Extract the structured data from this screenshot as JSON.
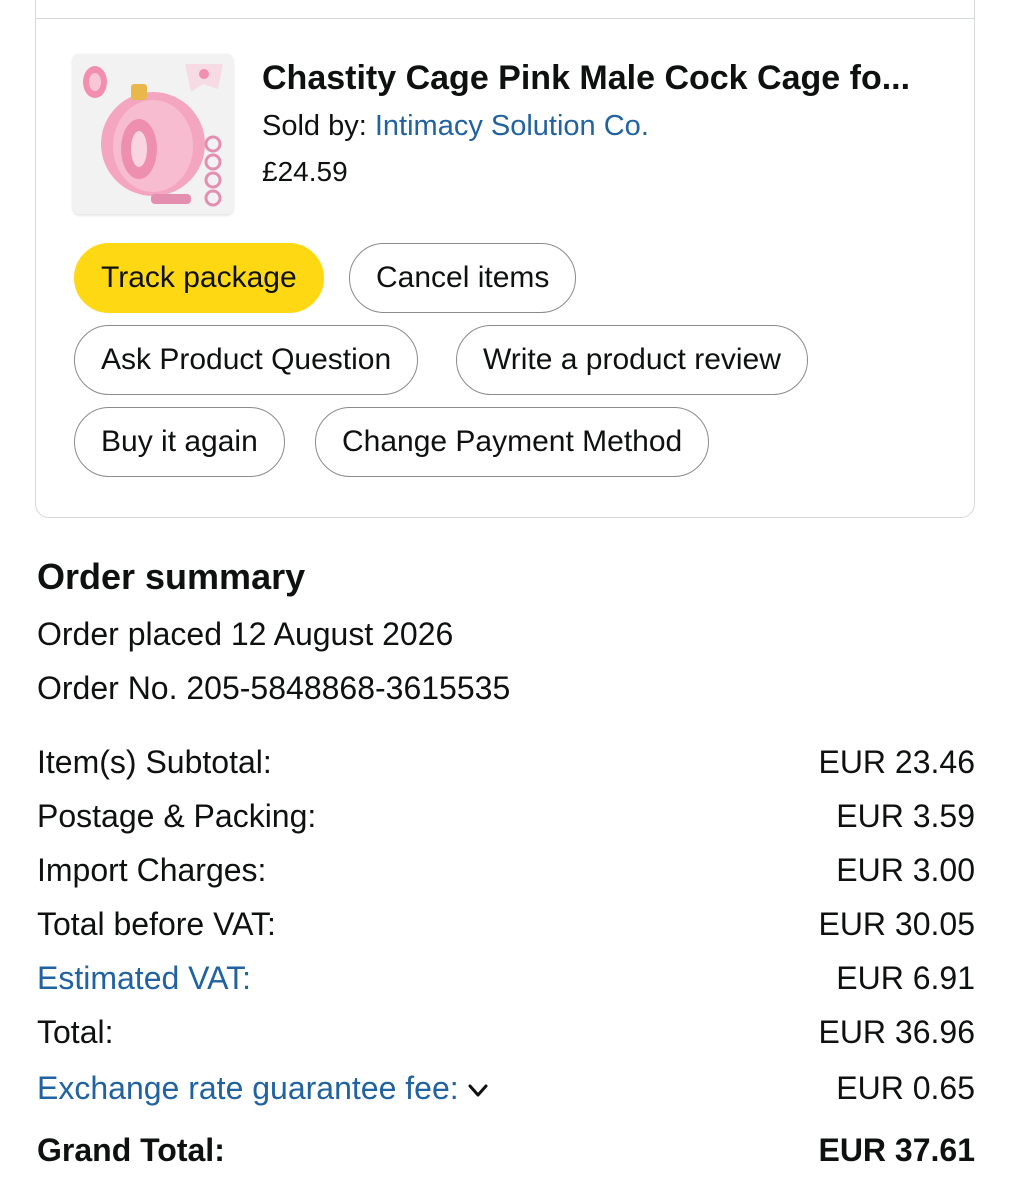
{
  "product": {
    "title": "Chastity Cage Pink Male Cock Cage fo...",
    "sold_by_label": "Sold by:",
    "seller": "Intimacy Solution Co.",
    "price": "£24.59"
  },
  "actions": {
    "track_package": "Track package",
    "cancel_items": "Cancel items",
    "ask_question": "Ask Product Question",
    "write_review": "Write a product review",
    "buy_again": "Buy it again",
    "change_payment": "Change Payment Method"
  },
  "summary": {
    "title": "Order summary",
    "order_placed": "Order placed 12 August 2026",
    "order_number": "Order No. 205-5848868-3615535",
    "lines": [
      {
        "label": "Item(s) Subtotal:",
        "value": "EUR 23.46"
      },
      {
        "label": "Postage & Packing:",
        "value": "EUR 3.59"
      },
      {
        "label": "Import Charges:",
        "value": "EUR 3.00"
      },
      {
        "label": "Total before VAT:",
        "value": "EUR 30.05"
      },
      {
        "label": "Estimated VAT:",
        "value": "EUR 6.91"
      },
      {
        "label": "Total:",
        "value": "EUR 36.96"
      },
      {
        "label": "Exchange rate guarantee fee:",
        "value": "EUR 0.65"
      },
      {
        "label": "Grand Total:",
        "value": "EUR 37.61"
      }
    ]
  },
  "colors": {
    "primary_button": "#ffd814",
    "link": "#2162a1",
    "text": "#0f1111",
    "border": "#888c8c"
  }
}
